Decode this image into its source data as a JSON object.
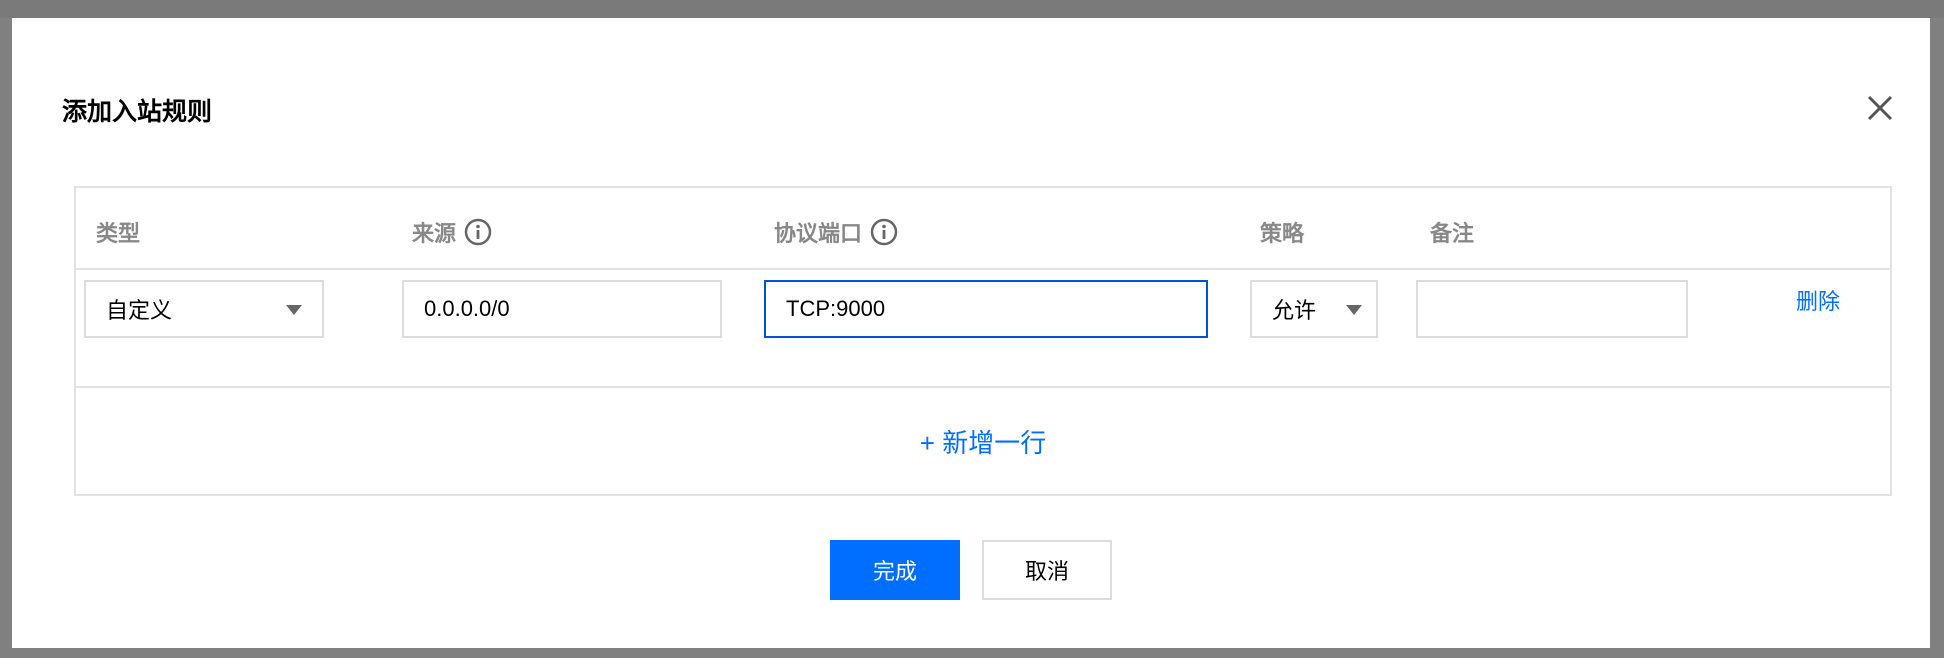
{
  "dialog": {
    "title": "添加入站规则"
  },
  "table": {
    "headers": {
      "type": "类型",
      "source": "来源",
      "protocol_port": "协议端口",
      "policy": "策略",
      "note": "备注"
    },
    "row": {
      "type_value": "自定义",
      "source_value": "0.0.0.0/0",
      "protocol_port_value": "TCP:9000",
      "policy_value": "允许",
      "note_value": "",
      "delete_label": "删除"
    },
    "add_row_label": "+ 新增一行"
  },
  "footer": {
    "confirm_label": "完成",
    "cancel_label": "取消"
  },
  "colors": {
    "primary": "#006eff",
    "focus_border": "#0052d9",
    "backdrop": "#808080"
  },
  "icons": {
    "close": "close-icon",
    "info": "info-icon",
    "dropdown": "chevron-down-icon"
  }
}
